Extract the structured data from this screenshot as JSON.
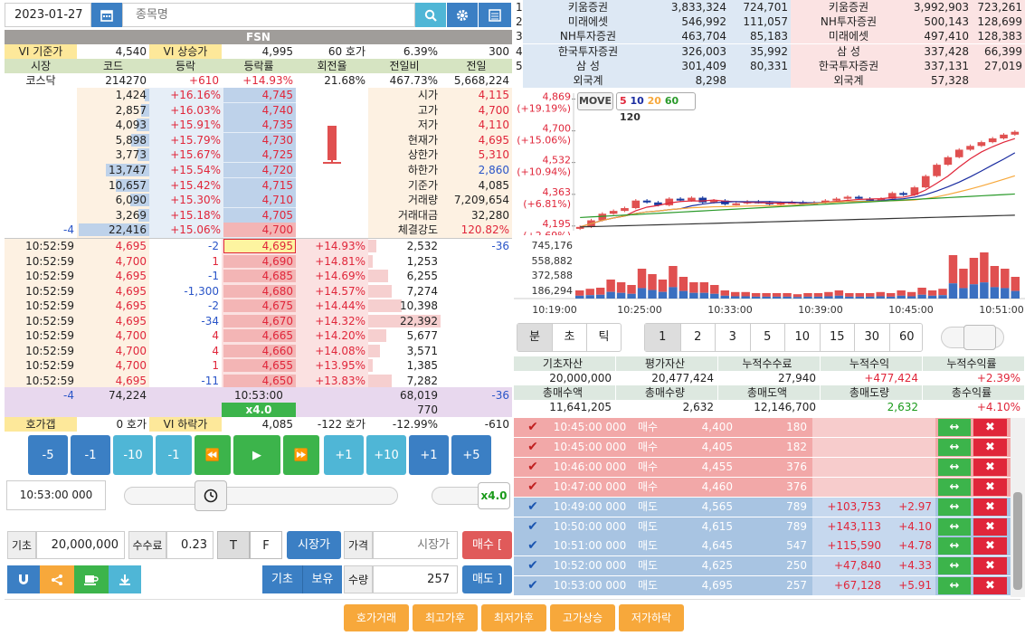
{
  "header": {
    "date": "2023-01-27",
    "search_placeholder": "종목명",
    "stock_name": "FSN"
  },
  "colors": {
    "up": "#e0263a",
    "down": "#2a55c8",
    "header_bg": "#a09d9a",
    "green_btn": "#3cb44b",
    "accent_orange": "#f7a83b",
    "blue_btn": "#3b7fc4",
    "teal_btn": "#4fb6d6"
  },
  "vi_row": {
    "label1": "VI 기준가",
    "v1": "4,540",
    "label2": "VI 상승가",
    "v2": "4,995",
    "v3": "60 호가",
    "v4": "6.39%",
    "v5": "300"
  },
  "col_headers": [
    "시장",
    "코드",
    "등락",
    "등락률",
    "회전율",
    "전일비",
    "전일"
  ],
  "info_row": [
    "코스닥",
    "214270",
    "+610",
    "+14.93%",
    "21.68%",
    "467.73%",
    "5,668,224"
  ],
  "ask_rows": [
    {
      "qty": "1,424",
      "pct": "+16.16%",
      "price": "4,745",
      "qfill": 0.06
    },
    {
      "qty": "2,857",
      "pct": "+16.03%",
      "price": "4,740",
      "qfill": 0.12
    },
    {
      "qty": "4,093",
      "pct": "+15.91%",
      "price": "4,735",
      "qfill": 0.18
    },
    {
      "qty": "5,898",
      "pct": "+15.79%",
      "price": "4,730",
      "qfill": 0.26
    },
    {
      "qty": "3,773",
      "pct": "+15.67%",
      "price": "4,725",
      "qfill": 0.17
    },
    {
      "qty": "13,747",
      "pct": "+15.54%",
      "price": "4,720",
      "qfill": 0.61
    },
    {
      "qty": "10,657",
      "pct": "+15.42%",
      "price": "4,715",
      "qfill": 0.47
    },
    {
      "qty": "6,090",
      "pct": "+15.30%",
      "price": "4,710",
      "qfill": 0.27
    },
    {
      "qty": "3,269",
      "pct": "+15.18%",
      "price": "4,705",
      "qfill": 0.15
    },
    {
      "qty": "22,416",
      "pct": "+15.06%",
      "price": "4,700",
      "qfill": 1.0,
      "chg": "-4"
    }
  ],
  "quote_summary": [
    {
      "label": "시가",
      "value": "4,115",
      "tone": "red"
    },
    {
      "label": "고가",
      "value": "4,700",
      "tone": "red"
    },
    {
      "label": "저가",
      "value": "4,110",
      "tone": "red"
    },
    {
      "label": "현재가",
      "value": "4,695",
      "tone": "red"
    },
    {
      "label": "상한가",
      "value": "5,310",
      "tone": "red"
    },
    {
      "label": "하한가",
      "value": "2,860",
      "tone": "blue"
    },
    {
      "label": "기준가",
      "value": "4,085",
      "tone": "dark"
    },
    {
      "label": "거래량",
      "value": "7,209,654",
      "tone": "dark"
    },
    {
      "label": "거래대금",
      "value": "32,280",
      "tone": "dark"
    },
    {
      "label": "체결강도",
      "value": "120.82%",
      "tone": "red"
    }
  ],
  "ticks": [
    {
      "time": "10:52:59",
      "price": "4,695",
      "chg": "-2",
      "bid": "4,695",
      "pct": "+14.93%",
      "vol": "2,532",
      "extra": "-36",
      "vfill": 0.11
    },
    {
      "time": "10:52:59",
      "price": "4,700",
      "chg": "1",
      "bid": "4,690",
      "pct": "+14.81%",
      "vol": "1,253",
      "vfill": 0.06
    },
    {
      "time": "10:52:59",
      "price": "4,695",
      "chg": "-1",
      "bid": "4,685",
      "pct": "+14.69%",
      "vol": "6,255",
      "vfill": 0.28
    },
    {
      "time": "10:52:59",
      "price": "4,695",
      "chg": "-1,300",
      "bid": "4,680",
      "pct": "+14.57%",
      "vol": "7,274",
      "vfill": 0.33
    },
    {
      "time": "10:52:59",
      "price": "4,695",
      "chg": "-2",
      "bid": "4,675",
      "pct": "+14.44%",
      "vol": "10,398",
      "vfill": 0.46
    },
    {
      "time": "10:52:59",
      "price": "4,695",
      "chg": "-34",
      "bid": "4,670",
      "pct": "+14.32%",
      "vol": "22,392",
      "vfill": 1.0
    },
    {
      "time": "10:52:59",
      "price": "4,700",
      "chg": "4",
      "bid": "4,665",
      "pct": "+14.20%",
      "vol": "5,677",
      "vfill": 0.25
    },
    {
      "time": "10:52:59",
      "price": "4,700",
      "chg": "4",
      "bid": "4,660",
      "pct": "+14.08%",
      "vol": "3,571",
      "vfill": 0.16
    },
    {
      "time": "10:52:59",
      "price": "4,700",
      "chg": "1",
      "bid": "4,655",
      "pct": "+13.95%",
      "vol": "1,385",
      "vfill": 0.06
    },
    {
      "time": "10:52:59",
      "price": "4,695",
      "chg": "-11",
      "bid": "4,650",
      "pct": "+13.83%",
      "vol": "7,282",
      "vfill": 0.33
    }
  ],
  "totals": {
    "left_chg": "-4",
    "ask_total": "74,224",
    "time": "10:53:00",
    "bid_total": "68,019",
    "right_chg": "-36",
    "speed": "x4.0",
    "extra": "770"
  },
  "bottom_row": {
    "label1": "호가갭",
    "v1": "0 호가",
    "label2": "VI 하락가",
    "v2": "4,085",
    "v3": "-122 호가",
    "v4": "-12.99%",
    "v5": "-610"
  },
  "controls": {
    "buttons": [
      "-5",
      "-1",
      "-10",
      "-1",
      "⏪",
      "▶",
      "⏩",
      "+1",
      "+10",
      "+1",
      "+5"
    ],
    "time_value": "10:53:00 000",
    "speed_label": "x4.0"
  },
  "order_form": {
    "base_label": "기초",
    "base_value": "20,000,000",
    "fee_label": "수수료",
    "fee_value": "0.23",
    "t_label": "T",
    "f_label": "F",
    "market_btn": "시장가",
    "price_label": "가격",
    "price_placeholder": "시장가",
    "buy_btn": "매수 [",
    "base_btn": "기초",
    "hold_btn": "보유",
    "qty_label": "수량",
    "qty_value": "257",
    "sell_btn": "매도 ]"
  },
  "footer_buttons": [
    "호가거래",
    "최고가후",
    "최저가후",
    "고가상승",
    "저가하락"
  ],
  "broker_table": [
    {
      "n": "1",
      "s_name": "키움증권",
      "s_amt": "3,833,324",
      "s_qty": "724,701",
      "b_name": "키움증권",
      "b_amt": "3,992,903",
      "b_qty": "723,261"
    },
    {
      "n": "2",
      "s_name": "미래에셋",
      "s_amt": "546,992",
      "s_qty": "111,057",
      "b_name": "NH투자증권",
      "b_amt": "500,143",
      "b_qty": "128,699"
    },
    {
      "n": "3",
      "s_name": "NH투자증권",
      "s_amt": "463,704",
      "s_qty": "85,183",
      "b_name": "미래에셋",
      "b_amt": "497,410",
      "b_qty": "128,383"
    },
    {
      "n": "4",
      "s_name": "한국투자증권",
      "s_amt": "326,003",
      "s_qty": "35,992",
      "b_name": "삼 성",
      "b_amt": "337,428",
      "b_qty": "66,399"
    },
    {
      "n": "5",
      "s_name": "삼 성",
      "s_amt": "301,409",
      "s_qty": "80,331",
      "b_name": "한국투자증권",
      "b_amt": "337,131",
      "b_qty": "27,019"
    }
  ],
  "foreign_row": {
    "label": "외국계",
    "s_amt": "8,298",
    "b_label": "외국계",
    "b_amt": "57,328"
  },
  "chart_data": [
    {
      "type": "candlestick",
      "move_label": "MOVE",
      "ma_periods": [
        "5",
        "10",
        "20",
        "60",
        "120"
      ],
      "y_ticks": [
        {
          "price": "4,869",
          "pct": "(+19.19%)"
        },
        {
          "price": "4,700",
          "pct": "(+15.06%)"
        },
        {
          "price": "4,532",
          "pct": "(+10.94%)"
        },
        {
          "price": "4,363",
          "pct": "(+6.81%)"
        },
        {
          "price": "4,195",
          "pct": "(+2.69%)"
        }
      ],
      "ylim": [
        4170,
        4900
      ]
    },
    {
      "type": "bar",
      "y_ticks": [
        "745,176",
        "558,882",
        "372,588",
        "186,294"
      ],
      "x_ticks": [
        "10:19:00",
        "10:25:00",
        "10:33:00",
        "10:39:00",
        "10:45:00",
        "10:51:00"
      ]
    }
  ],
  "period_tabs": [
    "분",
    "초",
    "틱"
  ],
  "interval_tabs": [
    "1",
    "2",
    "3",
    "5",
    "10",
    "15",
    "30",
    "60"
  ],
  "account": {
    "h1": [
      "기초자산",
      "평가자산",
      "누적수수료",
      "누적수익",
      "누적수익률"
    ],
    "v1": [
      "20,000,000",
      "20,477,424",
      "27,940",
      "+477,424",
      "+2.39%"
    ],
    "h2": [
      "총매수액",
      "총매수량",
      "총매도액",
      "총매도량",
      "총수익률"
    ],
    "v2": [
      "11,641,205",
      "2,632",
      "12,146,700",
      "2,632",
      "+4.10%"
    ]
  },
  "trades": [
    {
      "time": "10:45:00 000",
      "side": "매수",
      "price": "4,400",
      "qty": "180",
      "pnl": "",
      "rate": "",
      "buy": true
    },
    {
      "time": "10:45:00 000",
      "side": "매수",
      "price": "4,405",
      "qty": "182",
      "pnl": "",
      "rate": "",
      "buy": true
    },
    {
      "time": "10:46:00 000",
      "side": "매수",
      "price": "4,455",
      "qty": "376",
      "pnl": "",
      "rate": "",
      "buy": true
    },
    {
      "time": "10:47:00 000",
      "side": "매수",
      "price": "4,460",
      "qty": "376",
      "pnl": "",
      "rate": "",
      "buy": true
    },
    {
      "time": "10:49:00 000",
      "side": "매도",
      "price": "4,565",
      "qty": "789",
      "pnl": "+103,753",
      "rate": "+2.97",
      "buy": false
    },
    {
      "time": "10:50:00 000",
      "side": "매도",
      "price": "4,615",
      "qty": "789",
      "pnl": "+143,113",
      "rate": "+4.10",
      "buy": false
    },
    {
      "time": "10:51:00 000",
      "side": "매도",
      "price": "4,645",
      "qty": "547",
      "pnl": "+115,590",
      "rate": "+4.78",
      "buy": false
    },
    {
      "time": "10:52:00 000",
      "side": "매도",
      "price": "4,625",
      "qty": "250",
      "pnl": "+47,840",
      "rate": "+4.33",
      "buy": false
    },
    {
      "time": "10:53:00 000",
      "side": "매도",
      "price": "4,695",
      "qty": "257",
      "pnl": "+67,128",
      "rate": "+5.91",
      "buy": false
    }
  ]
}
